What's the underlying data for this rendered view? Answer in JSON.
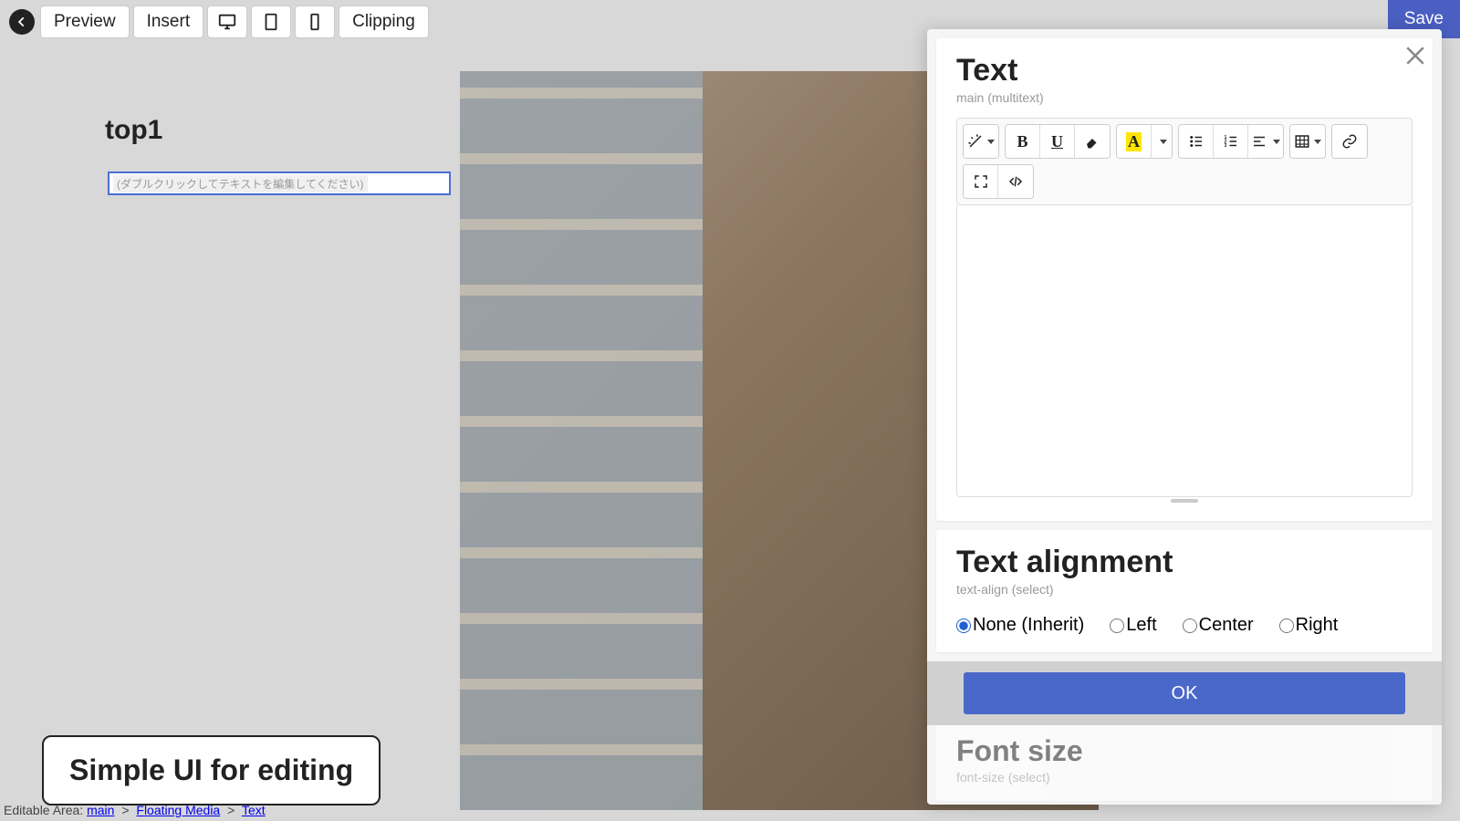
{
  "topbar": {
    "preview": "Preview",
    "insert": "Insert",
    "clipping": "Clipping",
    "save": "Save"
  },
  "canvas": {
    "page_title": "top1",
    "placeholder_text": "(ダブルクリックしてテキストを編集してください)"
  },
  "callout": "Simple UI for editing",
  "breadcrumb": {
    "label": "Editable Area:",
    "items": [
      "main",
      "Floating Media",
      "Text"
    ]
  },
  "panel": {
    "text": {
      "title": "Text",
      "sub": "main (multitext)"
    },
    "alignment": {
      "title": "Text alignment",
      "sub": "text-align (select)",
      "options": {
        "none": "None (Inherit)",
        "left": "Left",
        "center": "Center",
        "right": "Right"
      },
      "selected": "none"
    },
    "ok": "OK",
    "fontsize": {
      "title": "Font size",
      "sub": "font-size (select)"
    }
  }
}
